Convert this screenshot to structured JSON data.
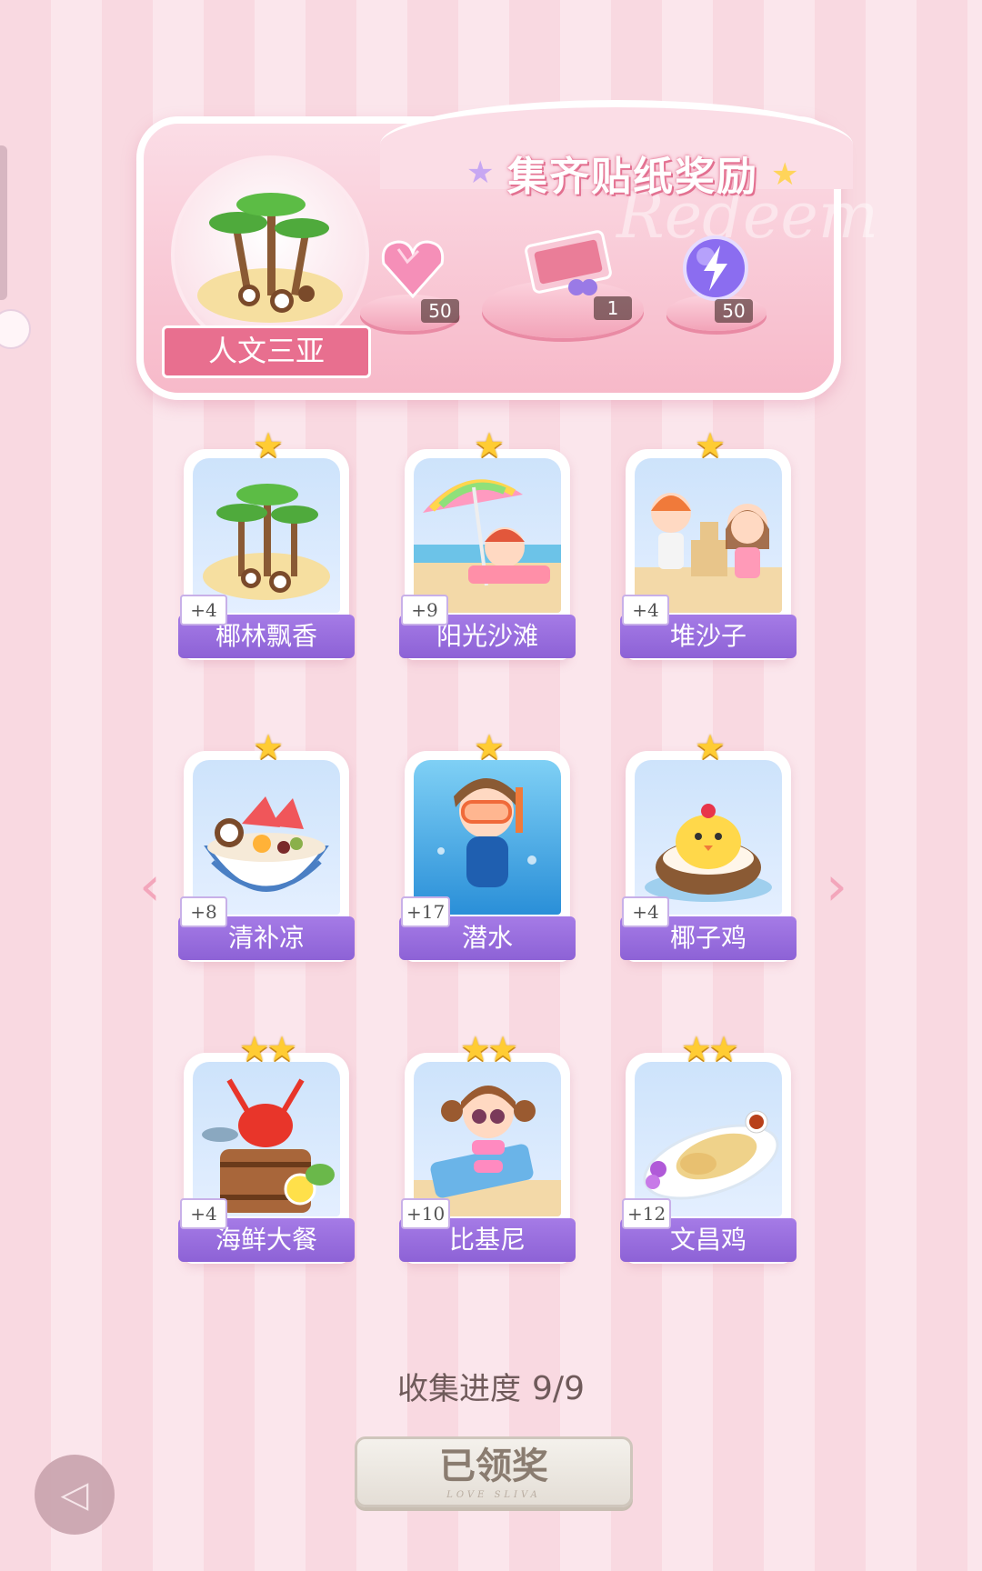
{
  "reward_panel": {
    "title": "集齐贴纸奖励",
    "watermark": "Redeem",
    "set_name": "人文三亚",
    "rewards": [
      {
        "icon": "pink-heart-gem-icon",
        "count": "50"
      },
      {
        "icon": "gift-box-icon",
        "count": "1"
      },
      {
        "icon": "purple-energy-orb-icon",
        "count": "50"
      }
    ]
  },
  "cards": [
    {
      "name": "椰林飘香",
      "points": "+4",
      "stars": "★",
      "art": "coconut-island-art"
    },
    {
      "name": "阳光沙滩",
      "points": "+9",
      "stars": "★",
      "art": "beach-umbrella-art"
    },
    {
      "name": "堆沙子",
      "points": "+4",
      "stars": "★",
      "art": "sandcastle-kids-art"
    },
    {
      "name": "清补凉",
      "points": "+8",
      "stars": "★",
      "art": "dessert-bowl-art"
    },
    {
      "name": "潜水",
      "points": "+17",
      "stars": "★",
      "art": "diver-girl-art"
    },
    {
      "name": "椰子鸡",
      "points": "+4",
      "stars": "★",
      "art": "coconut-chick-art"
    },
    {
      "name": "海鲜大餐",
      "points": "+4",
      "stars": "★★",
      "art": "seafood-barrel-art"
    },
    {
      "name": "比基尼",
      "points": "+10",
      "stars": "★★",
      "art": "bikini-girl-art"
    },
    {
      "name": "文昌鸡",
      "points": "+12",
      "stars": "★★",
      "art": "wenchang-chicken-art"
    }
  ],
  "progress": {
    "label": "收集进度",
    "value": "9/9"
  },
  "claim_button": {
    "label": "已领奖",
    "sub": "LOVE SLIVA"
  },
  "colors": {
    "accent_purple": "#9a6fe0",
    "panel_pink": "#f7b9c9",
    "star_gold": "#ffcc33"
  }
}
